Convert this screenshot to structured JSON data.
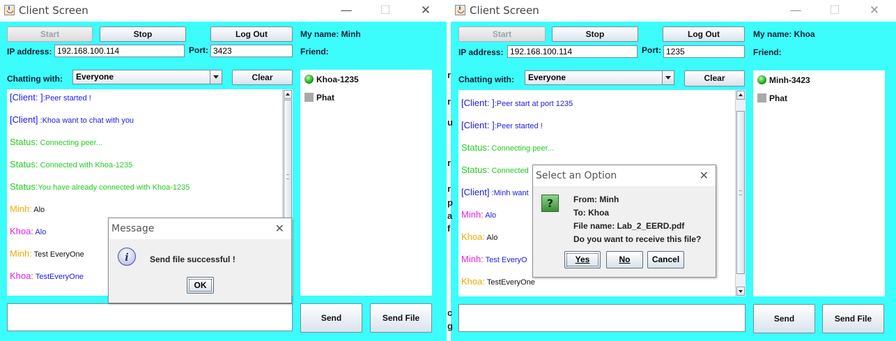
{
  "windows": [
    {
      "title": "Client Screen",
      "titlebar_controls": {
        "minimize": "—",
        "maximize": "☐",
        "close": "✕"
      },
      "buttons": {
        "start": "Start",
        "stop": "Stop",
        "logout": "Log Out",
        "clear": "Clear",
        "send": "Send",
        "send_file": "Send File"
      },
      "my_name": "My name: Minh",
      "friend_label": "Friend:",
      "ip_label": "IP address:",
      "ip_value": "192.168.100.114",
      "port_label": "Port:",
      "port_value": "3423",
      "chatting_with_label": "Chatting with:",
      "chatting_with_value": "Everyone",
      "messages": [
        {
          "prefix": "[Client: ]",
          "text": ":Peer started !",
          "prefix_color": "#1a1ae6",
          "text_color": "#1a1ae6"
        },
        {
          "prefix": "[Client]",
          "text": " :Khoa want to chat with you",
          "prefix_color": "#1a1ae6",
          "text_color": "#1a1ae6"
        },
        {
          "prefix": "Status:",
          "text": " Connecting peer...",
          "prefix_color": "#22cc22",
          "text_color": "#22cc22"
        },
        {
          "prefix": "Status:",
          "text": " Connected with Khoa-1235",
          "prefix_color": "#22cc22",
          "text_color": "#22cc22"
        },
        {
          "prefix": "Status:",
          "text": "You have already connected with Khoa-1235",
          "prefix_color": "#22cc22",
          "text_color": "#22cc22"
        },
        {
          "prefix": "Minh:",
          "text": " Alo",
          "prefix_color": "#f2a900",
          "text_color": "#111111"
        },
        {
          "prefix": "Khoa:",
          "text": " Alo",
          "prefix_color": "#e61ee6",
          "text_color": "#1a1ae6"
        },
        {
          "prefix": "Minh:",
          "text": " Test EveryOne",
          "prefix_color": "#f2a900",
          "text_color": "#111111"
        },
        {
          "prefix": "Khoa:",
          "text": " TestEveryOne",
          "prefix_color": "#e61ee6",
          "text_color": "#1a1ae6"
        }
      ],
      "friends": [
        {
          "name": "Khoa-1235",
          "status": "online",
          "icon": "online-icon"
        },
        {
          "name": "Phat",
          "status": "offline",
          "icon": "offline-icon"
        }
      ],
      "dialog": {
        "title": "Message",
        "close": "✕",
        "icon": "info-icon",
        "icon_glyph": "i",
        "text": "Send file successful !",
        "ok": "OK"
      }
    },
    {
      "title": "Client Screen",
      "titlebar_controls": {
        "minimize": "—",
        "maximize": "☐",
        "close": "✕"
      },
      "buttons": {
        "start": "Start",
        "stop": "Stop",
        "logout": "Log Out",
        "clear": "Clear",
        "send": "Send",
        "send_file": "Send File"
      },
      "my_name": "My name: Khoa",
      "friend_label": "Friend:",
      "ip_label": "IP address:",
      "ip_value": "192.168.100.114",
      "port_label": "Port:",
      "port_value": "1235",
      "chatting_with_label": "Chatting with:",
      "chatting_with_value": "Everyone",
      "messages": [
        {
          "prefix": "[Client: ]",
          "text": ":Peer start at port 1235",
          "prefix_color": "#1a1ae6",
          "text_color": "#1a1ae6"
        },
        {
          "prefix": "[Client: ]",
          "text": ":Peer started !",
          "prefix_color": "#1a1ae6",
          "text_color": "#1a1ae6"
        },
        {
          "prefix": "Status:",
          "text": " Connecting peer...",
          "prefix_color": "#22cc22",
          "text_color": "#22cc22"
        },
        {
          "prefix": "Status:",
          "text": " Connected",
          "prefix_color": "#22cc22",
          "text_color": "#22cc22"
        },
        {
          "prefix": "[Client]",
          "text": " :Minh want",
          "prefix_color": "#1a1ae6",
          "text_color": "#1a1ae6"
        },
        {
          "prefix": "Minh:",
          "text": " Alo",
          "prefix_color": "#e61ee6",
          "text_color": "#1a1ae6"
        },
        {
          "prefix": "Khoa:",
          "text": " Alo",
          "prefix_color": "#f2a900",
          "text_color": "#111111"
        },
        {
          "prefix": "Minh:",
          "text": " Test EveryO",
          "prefix_color": "#e61ee6",
          "text_color": "#1a1ae6"
        },
        {
          "prefix": "Khoa:",
          "text": " TestEveryOne",
          "prefix_color": "#f2a900",
          "text_color": "#111111"
        }
      ],
      "friends": [
        {
          "name": "Minh-3423",
          "status": "online",
          "icon": "online-icon"
        },
        {
          "name": "Phat",
          "status": "offline",
          "icon": "offline-icon"
        }
      ],
      "dialog": {
        "title": "Select an Option",
        "close": "✕",
        "icon": "question-icon",
        "icon_glyph": "?",
        "lines": [
          "From: Minh",
          "To: Khoa",
          "File name: Lab_2_EERD.pdf",
          "Do you want to receive this file?"
        ],
        "yes": "Yes",
        "no": "No",
        "cancel": "Cancel"
      }
    }
  ],
  "stray_chars": [
    "r",
    "r",
    "u",
    "r",
    "r",
    "p",
    "a",
    "f",
    "c",
    "g"
  ]
}
